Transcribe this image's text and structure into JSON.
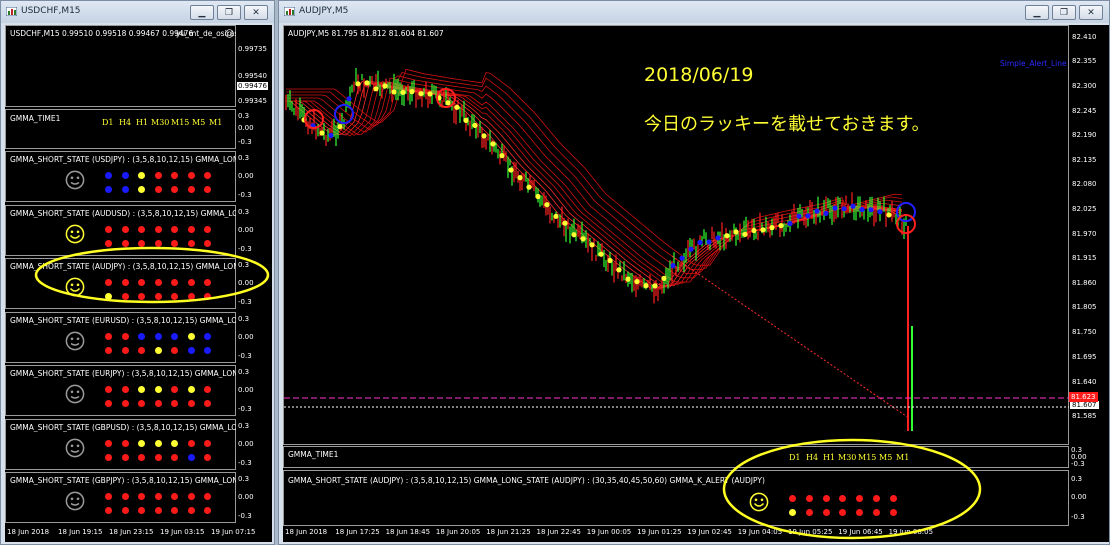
{
  "colors": {
    "up_bar": "#33ff33",
    "red": "#ff1a1a",
    "blue": "#1a1aff",
    "yellow": "#ffff33",
    "gray": "#9a9a9a",
    "pink": "#ff33cc"
  },
  "left_window": {
    "title": "USDCHF,M15",
    "main_chart": {
      "header": "USDCHF,M15  0.99510 0.99518 0.99467 0.99476",
      "overlay_label": "yu_mt_de_osirase",
      "y_labels": [
        "0.99735",
        "0.99540",
        "0.99476",
        "0.99345"
      ],
      "current_price": "0.99476"
    },
    "time_panel": {
      "title": "GMMA_TIME1",
      "timeframes": [
        "D1",
        "H4",
        "H1",
        "M30",
        "M15",
        "M5",
        "M1"
      ],
      "y_labels": [
        "0.3",
        "0.00",
        "-0.3"
      ]
    },
    "pair_panels": [
      {
        "title": "GMMA_SHORT_STATE (USDJPY) : (3,5,8,10,12,15)  GMMA_LONG",
        "face": "sad",
        "row1": [
          "blue",
          "blue",
          "yellow",
          "red",
          "red",
          "red",
          "red"
        ],
        "row2": [
          "blue",
          "blue",
          "yellow",
          "red",
          "red",
          "red",
          "red"
        ],
        "y_labels": [
          "0.3",
          "0.00",
          "-0.3"
        ]
      },
      {
        "title": "GMMA_SHORT_STATE (AUDUSD) : (3,5,8,10,12,15)  GMMA_LONG",
        "face": "happy",
        "row1": [
          "red",
          "red",
          "red",
          "red",
          "red",
          "red",
          "red"
        ],
        "row2": [
          "red",
          "red",
          "red",
          "red",
          "red",
          "red",
          "red"
        ],
        "y_labels": [
          "0.3",
          "0.00",
          "-0.3"
        ]
      },
      {
        "title": "GMMA_SHORT_STATE (AUDJPY) : (3,5,8,10,12,15)  GMMA_LONG",
        "face": "happy",
        "row1": [
          "red",
          "red",
          "red",
          "red",
          "red",
          "red",
          "red"
        ],
        "row2": [
          "yellow",
          "red",
          "red",
          "red",
          "red",
          "red",
          "red"
        ],
        "y_labels": [
          "0.3",
          "0.00",
          "-0.3"
        ]
      },
      {
        "title": "GMMA_SHORT_STATE (EURUSD) : (3,5,8,10,12,15)  GMMA_LONG",
        "face": "sad",
        "row1": [
          "red",
          "red",
          "blue",
          "blue",
          "blue",
          "yellow",
          "blue"
        ],
        "row2": [
          "red",
          "red",
          "red",
          "yellow",
          "red",
          "blue",
          "blue"
        ],
        "y_labels": [
          "0.3",
          "0.00",
          "-0.3"
        ]
      },
      {
        "title": "GMMA_SHORT_STATE (EURJPY) : (3,5,8,10,12,15)  GMMA_LONG",
        "face": "sad",
        "row1": [
          "red",
          "red",
          "yellow",
          "yellow",
          "red",
          "yellow",
          "red"
        ],
        "row2": [
          "red",
          "red",
          "red",
          "red",
          "red",
          "red",
          "red"
        ],
        "y_labels": [
          "0.3",
          "0.00",
          "-0.3"
        ]
      },
      {
        "title": "GMMA_SHORT_STATE (GBPUSD) : (3,5,8,10,12,15)  GMMA_LONG",
        "face": "sad",
        "row1": [
          "red",
          "red",
          "yellow",
          "yellow",
          "yellow",
          "red",
          "red"
        ],
        "row2": [
          "red",
          "red",
          "red",
          "red",
          "red",
          "blue",
          "red"
        ],
        "y_labels": [
          "0.3",
          "0.00",
          "-0.3"
        ]
      },
      {
        "title": "GMMA_SHORT_STATE (GBPJPY) : (3,5,8,10,12,15)  GMMA_LONG",
        "face": "sad",
        "row1": [
          "red",
          "red",
          "red",
          "red",
          "red",
          "red",
          "red"
        ],
        "row2": [
          "red",
          "red",
          "red",
          "red",
          "red",
          "red",
          "red"
        ],
        "y_labels": [
          "0.3",
          "0.00",
          "-0.3"
        ]
      }
    ],
    "time_labels": [
      "18 Jun 2018",
      "18 Jun 19:15",
      "18 Jun 23:15",
      "19 Jun 03:15",
      "19 Jun 07:15"
    ]
  },
  "right_window": {
    "title": "AUDJPY,M5",
    "main_chart": {
      "header": "AUDJPY,M5  81.795 81.812 81.604 81.607",
      "alert_label": "Simple_Alert_Line",
      "y_labels": [
        "82.410",
        "82.355",
        "82.300",
        "82.245",
        "82.190",
        "82.135",
        "82.080",
        "82.025",
        "81.970",
        "81.915",
        "81.860",
        "81.805",
        "81.750",
        "81.695",
        "81.640",
        "81.607",
        "81.585"
      ],
      "alert_price": "81.623",
      "current_price": "81.607"
    },
    "time_panel": {
      "title": "GMMA_TIME1",
      "timeframes": [
        "D1",
        "H4",
        "H1",
        "M30",
        "M15",
        "M5",
        "M1"
      ],
      "y_labels": [
        "0.3",
        "0.00",
        "-0.3"
      ]
    },
    "state_panel": {
      "title": "GMMA_SHORT_STATE (AUDJPY) : (3,5,8,10,12,15)  GMMA_LONG_STATE (AUDJPY) : (30,35,40,45,50,60)  GMMA_K_ALERT (AUDJPY)",
      "face": "happy",
      "row1": [
        "red",
        "red",
        "red",
        "red",
        "red",
        "red",
        "red"
      ],
      "row2": [
        "yellow",
        "red",
        "red",
        "red",
        "red",
        "red",
        "red"
      ],
      "y_labels": [
        "0.3",
        "0.00",
        "-0.3"
      ]
    },
    "time_labels": [
      "18 Jun 2018",
      "18 Jun 17:25",
      "18 Jun 18:45",
      "18 Jun 20:05",
      "18 Jun 21:25",
      "18 Jun 22:45",
      "19 Jun 00:05",
      "19 Jun 01:25",
      "19 Jun 02:45",
      "19 Jun 04:05",
      "19 Jun 05:25",
      "19 Jun 06:45",
      "19 Jun 08:05"
    ]
  },
  "annotation": {
    "date": "2018/06/19",
    "message": "今日のラッキーを載せておきます。"
  },
  "window_buttons": {
    "minimize": "▁",
    "restore": "❐",
    "close": "✕"
  }
}
